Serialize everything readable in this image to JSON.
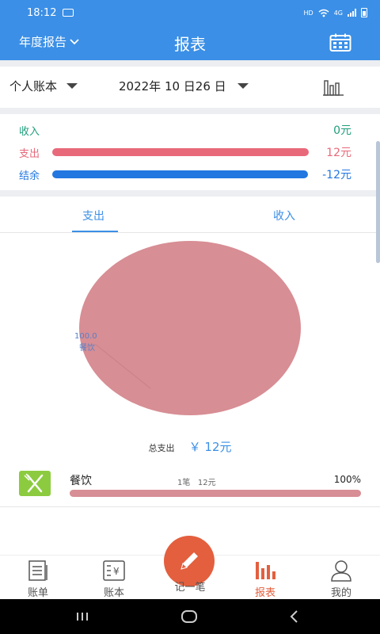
{
  "status_bar": {
    "time": "18:12",
    "network": "HD",
    "signal": "4G"
  },
  "header": {
    "report_type": "年度报告",
    "title": "报表"
  },
  "filters": {
    "book": "个人账本",
    "date": "2022年 10 日26 日"
  },
  "summary": {
    "income": {
      "label": "收入",
      "value": "0元",
      "ratio": 0
    },
    "expense": {
      "label": "支出",
      "value": "12元",
      "ratio": 1
    },
    "balance": {
      "label": "结余",
      "value": "-12元",
      "ratio": 1
    }
  },
  "tabs": [
    {
      "label": "支出",
      "active": true
    },
    {
      "label": "收入",
      "active": false
    }
  ],
  "chart_data": {
    "type": "pie",
    "slices": [
      {
        "label": "餐饮",
        "value": 100.0,
        "color": "#d78e94"
      }
    ],
    "labels": {
      "value": "100.0",
      "name": "餐饮"
    }
  },
  "total": {
    "label": "总支出",
    "value": "￥ 12元"
  },
  "categories": [
    {
      "name": "餐饮",
      "count": "1笔",
      "amount": "12元",
      "percent": "100%",
      "fraction": 1.0,
      "icon": "fork-knife-icon"
    }
  ],
  "bottom_nav": [
    {
      "label": "账单",
      "icon": "bill-icon"
    },
    {
      "label": "账本",
      "icon": "book-icon"
    },
    {
      "label": "记一笔",
      "icon": "pencil-icon"
    },
    {
      "label": "报表",
      "icon": "bar-chart-icon",
      "active": true
    },
    {
      "label": "我的",
      "icon": "user-icon"
    }
  ],
  "colors": {
    "primary": "#3b8fe6",
    "income": "#1f9e7c",
    "expense": "#e8697a",
    "balance": "#2277e0",
    "accent": "#e35f3e",
    "pie": "#d78e94"
  }
}
